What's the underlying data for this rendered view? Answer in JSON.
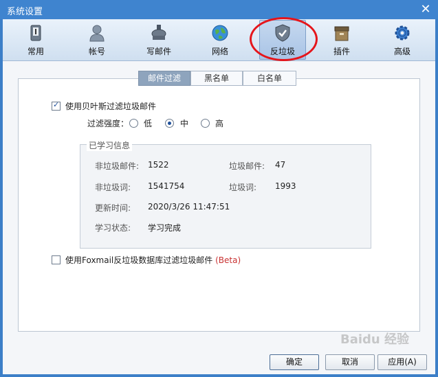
{
  "window": {
    "title": "系统设置"
  },
  "toolbar": {
    "items": [
      {
        "label": "常用",
        "icon": "phone-icon"
      },
      {
        "label": "帐号",
        "icon": "user-icon"
      },
      {
        "label": "写邮件",
        "icon": "compose-icon"
      },
      {
        "label": "网络",
        "icon": "globe-icon"
      },
      {
        "label": "反垃圾",
        "icon": "shield-icon",
        "active": true
      },
      {
        "label": "插件",
        "icon": "plugin-box-icon"
      },
      {
        "label": "高级",
        "icon": "gear-icon"
      }
    ]
  },
  "tabs": [
    {
      "label": "邮件过滤",
      "active": true
    },
    {
      "label": "黑名单"
    },
    {
      "label": "白名单"
    }
  ],
  "filter": {
    "bayes_label": "使用贝叶斯过滤垃圾邮件",
    "bayes_checked": true,
    "strength_label": "过滤强度：",
    "options": [
      "低",
      "中",
      "高"
    ],
    "selected": "中"
  },
  "learned": {
    "legend": "已学习信息",
    "non_spam_mail_label": "非垃圾邮件:",
    "non_spam_mail_value": "1522",
    "spam_mail_label": "垃圾邮件:",
    "spam_mail_value": "47",
    "non_spam_words_label": "非垃圾词:",
    "non_spam_words_value": "1541754",
    "spam_words_label": "垃圾词:",
    "spam_words_value": "1993",
    "update_time_label": "更新时间:",
    "update_time_value": "2020/3/26 11:47:51",
    "status_label": "学习状态:",
    "status_value": "学习完成"
  },
  "foxmail_db": {
    "label": "使用Foxmail反垃圾数据库过滤垃圾邮件",
    "beta": "(Beta)",
    "checked": false
  },
  "buttons": {
    "ok": "确定",
    "cancel": "取消",
    "apply": "应用(A)"
  },
  "watermark": "Baidu 经验",
  "colors": {
    "titlebar": "#3f84cf",
    "annotation": "#e5151b",
    "beta": "#c83232"
  }
}
